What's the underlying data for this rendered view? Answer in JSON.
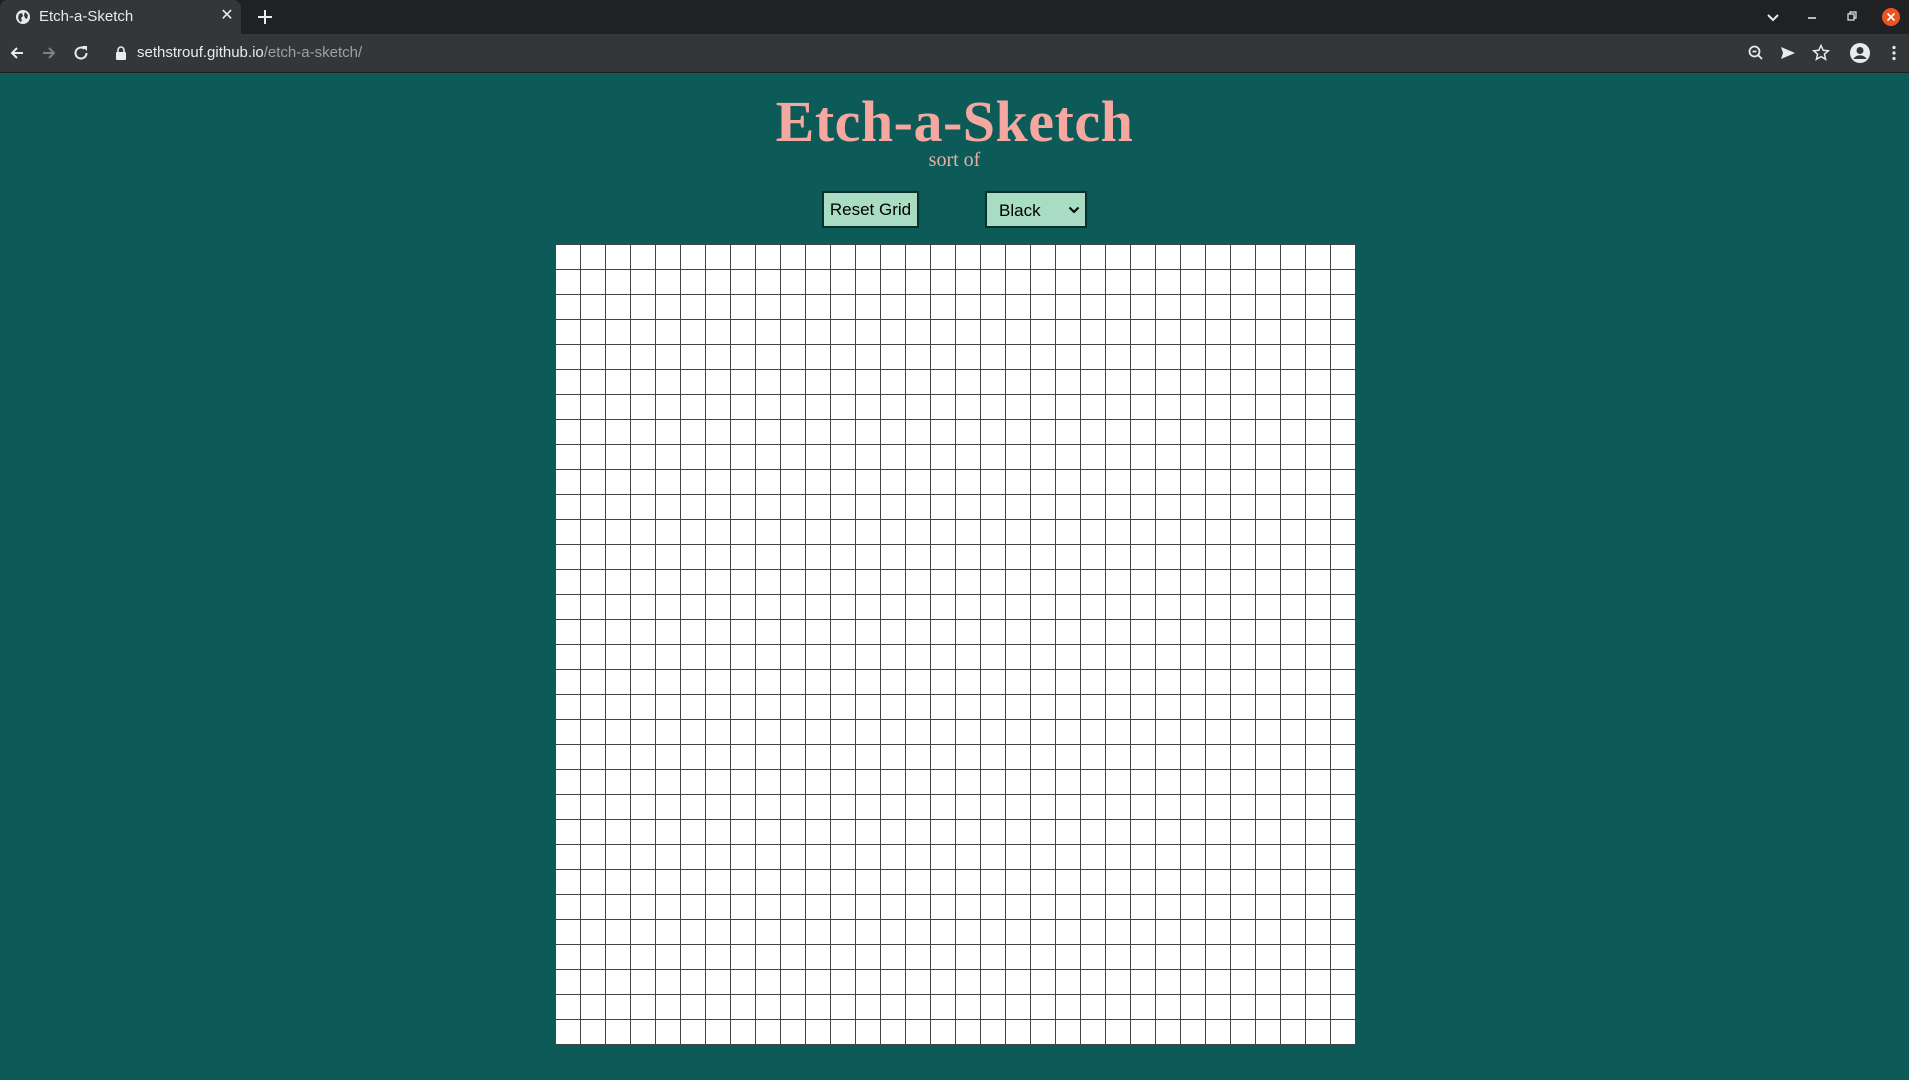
{
  "browser": {
    "tab_title": "Etch-a-Sketch",
    "url_host": "sethstrouf.github.io",
    "url_path": "/etch-a-sketch/"
  },
  "page": {
    "title": "Etch-a-Sketch",
    "subtitle": "sort of",
    "reset_label": "Reset Grid",
    "color_select": {
      "selected": "Black"
    },
    "grid_size": 32
  },
  "colors": {
    "background": "#0c5b58",
    "title": "#f4a8a0",
    "controls": "#a8dcc3",
    "cell": "#ffffff",
    "cell_border": "#444444"
  }
}
